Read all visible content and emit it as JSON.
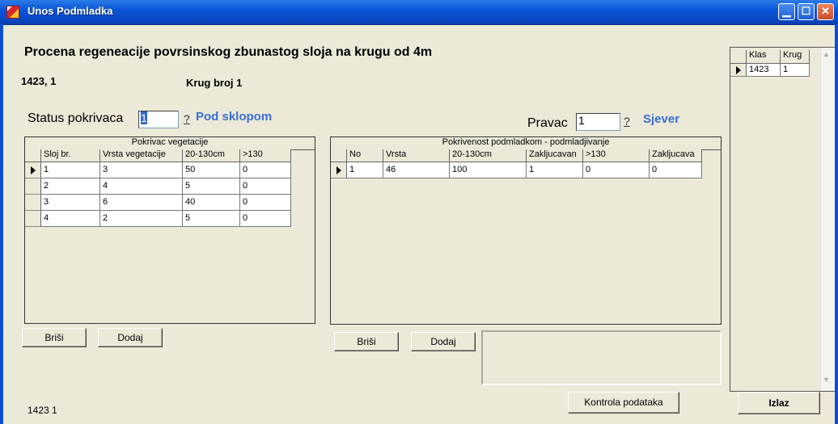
{
  "window": {
    "title": "Unos Podmladka"
  },
  "heading": "Procena regeneacije povrsinskog zbunastog sloja na krugu od 4m",
  "id_text": "1423, 1",
  "krug_text": "Krug broj 1",
  "status": {
    "label": "Status pokrivaca",
    "value": "1",
    "help": "?",
    "description": "Pod sklopom"
  },
  "pravac": {
    "label": "Pravac",
    "value": "1",
    "help": "?",
    "description": "Sjever"
  },
  "veg_grid": {
    "caption": "Pokrivac vegetacije",
    "headers": [
      "Sloj br.",
      "Vrsta vegetacije",
      "20-130cm",
      ">130"
    ],
    "rows": [
      [
        "1",
        "3",
        "50",
        "0"
      ],
      [
        "2",
        "4",
        "5",
        "0"
      ],
      [
        "3",
        "6",
        "40",
        "0"
      ],
      [
        "4",
        "2",
        "5",
        "0"
      ]
    ]
  },
  "podmladak_grid": {
    "caption": "Pokrivenost podmladkom - podmladjivanje",
    "headers": [
      "No",
      "Vrsta",
      "20-130cm",
      "Zakljucavan",
      ">130",
      "Zakljucava"
    ],
    "rows": [
      [
        "1",
        "46",
        "100",
        "1",
        "0",
        "0"
      ]
    ]
  },
  "side_grid": {
    "headers": [
      "Klas",
      "Krug"
    ],
    "rows": [
      [
        "1423",
        "1"
      ]
    ]
  },
  "buttons": {
    "brisi_left": "Briši",
    "dodaj_left": "Dodaj",
    "brisi_right": "Briši",
    "dodaj_right": "Dodaj",
    "kontrola": "Kontrola podataka",
    "izlaz": "Izlaz"
  },
  "status_bottom": "1423 1",
  "colors": {
    "titlebar": "#0a55d8",
    "accent_text": "#3a6fd0",
    "background": "#ece9d8"
  }
}
